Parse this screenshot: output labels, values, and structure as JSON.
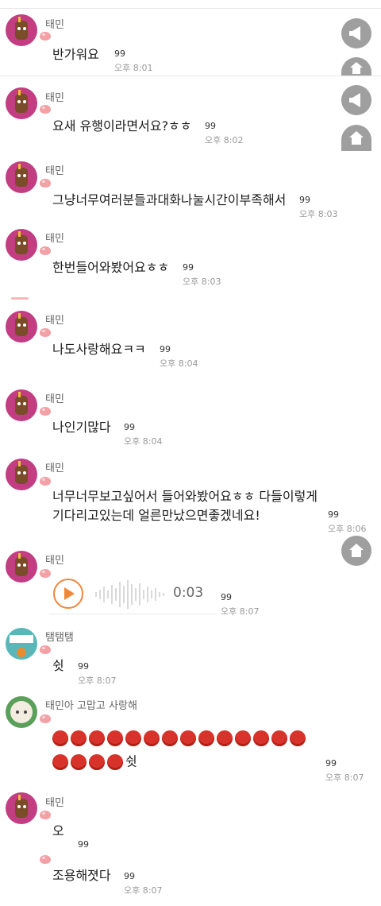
{
  "messages": [
    {
      "sender": "태민",
      "text": "반가워요",
      "count": "99",
      "time": "오후 8:01"
    },
    {
      "sender": "태민",
      "text": "요새 유행이라면서요?ㅎㅎ",
      "count": "99",
      "time": "오후 8:02"
    },
    {
      "sender": "태민",
      "text": "그냥너무여러분들과대화나눌시간이부족해서",
      "count": "99",
      "time": "오후 8:03"
    },
    {
      "sender": "태민",
      "text": "한번들어와봤어요ㅎㅎ",
      "count": "99",
      "time": "오후 8:03"
    },
    {
      "sender": "태민",
      "text": "나도사랑해요ㅋㅋ",
      "count": "99",
      "time": "오후 8:04"
    },
    {
      "sender": "태민",
      "text": "나인기많다",
      "count": "99",
      "time": "오후 8:04"
    },
    {
      "sender": "태민",
      "line1": "너무너무보고싶어서 들어와봤어요ㅎㅎ 다들이렇게",
      "line2": "기다리고있는데 얼른만났으면좋겠네요!",
      "count": "99",
      "time": "오후 8:06"
    },
    {
      "sender": "태민",
      "voice_duration": "0:03",
      "count": "99",
      "time": "오후 8:07"
    },
    {
      "sender": "탬탬탬",
      "text": "쉿",
      "count": "99",
      "time": "오후 8:07"
    },
    {
      "sender": "태민아 고맙고 사랑해",
      "suffix": "쉿",
      "count": "99",
      "time": "오후 8:07"
    },
    {
      "sender": "태민",
      "text": "오",
      "count": "99"
    },
    {
      "text": "조용해졋다",
      "count": "99",
      "time": "오후 8:07"
    }
  ],
  "colors": {
    "accent_voice": "#f0883a",
    "avatar_pink": "#c23d82",
    "fab_gray": "#9a9a9a",
    "red_dot": "#d7332b"
  },
  "icons": {
    "megaphone": "megaphone-icon",
    "home": "home-icon",
    "play": "play-icon"
  }
}
